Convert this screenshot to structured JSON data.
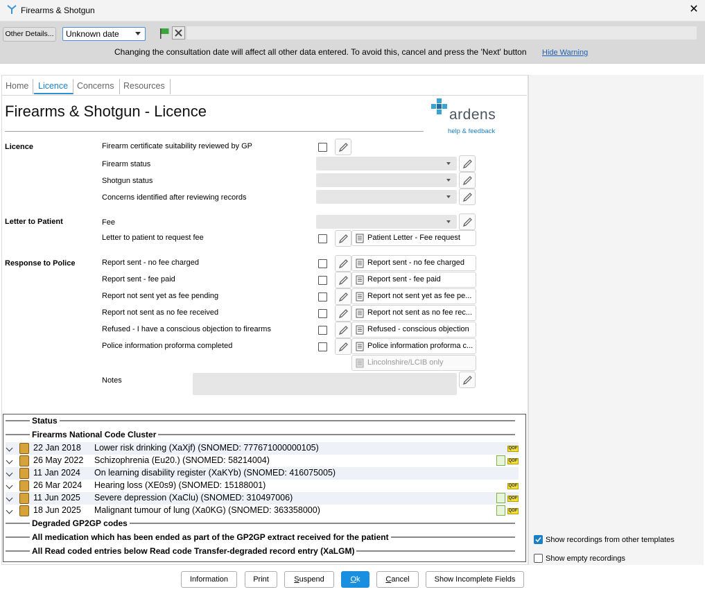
{
  "window": {
    "title": "Firearms & Shotgun",
    "close_glyph": "✕"
  },
  "topbar": {
    "other_details_label": "Other Details...",
    "date_value": "Unknown date",
    "warning_text": "Changing the consultation date will affect all other data entered. To avoid this, cancel and press the 'Next' button",
    "hide_warning_label": "Hide Warning"
  },
  "tabs": [
    {
      "label": "Home"
    },
    {
      "label": "Licence"
    },
    {
      "label": "Concerns"
    },
    {
      "label": "Resources"
    }
  ],
  "page_title": "Firearms & Shotgun - Licence",
  "logo": {
    "word": "ardens",
    "help": "help & feedback"
  },
  "sections": {
    "licence": {
      "heading": "Licence",
      "items": {
        "cert_review": "Firearm certificate suitability reviewed by GP",
        "firearm_status": "Firearm status",
        "shotgun_status": "Shotgun status",
        "concerns": "Concerns identified after reviewing records"
      }
    },
    "letter": {
      "heading": "Letter to Patient",
      "fee": "Fee",
      "letter_request": "Letter to patient to request fee",
      "letter_doc": "Patient Letter - Fee request"
    },
    "police": {
      "heading": "Response to Police",
      "rows": [
        {
          "label": "Report sent - no fee charged",
          "doc": "Report sent - no fee charged"
        },
        {
          "label": "Report sent - fee paid",
          "doc": "Report sent - fee paid"
        },
        {
          "label": "Report not sent yet as fee pending",
          "doc": "Report not sent yet as fee pe..."
        },
        {
          "label": "Report not sent as no fee received",
          "doc": "Report not sent as no fee rec..."
        },
        {
          "label": "Refused - I have a conscious objection to firearms",
          "doc": "Refused - conscious objection"
        },
        {
          "label": "Police information proforma completed",
          "doc": "Police information proforma c..."
        }
      ],
      "extra_doc": "Lincolnshire/LCIB only",
      "notes_label": "Notes"
    }
  },
  "status": {
    "heading": "Status",
    "cluster_heading": "Firearms National Code Cluster",
    "rows": [
      {
        "date": "22 Jan 2018",
        "desc": "Lower risk drinking (XaXjf) (SNOMED: 777671000000105)",
        "doc": false
      },
      {
        "date": "26 May 2022",
        "desc": "Schizophrenia (Eu20.) (SNOMED: 58214004)",
        "doc": true
      },
      {
        "date": "11 Jan 2024",
        "desc": "On learning disability register (XaKYb) (SNOMED: 416075005)",
        "doc": false
      },
      {
        "date": "26 Mar 2024",
        "desc": "Hearing loss (XE0s9) (SNOMED: 15188001)",
        "doc": false
      },
      {
        "date": "11 Jun 2025",
        "desc": "Severe depression (XaClu) (SNOMED: 310497006)",
        "doc": true
      },
      {
        "date": "18 Jun 2025",
        "desc": "Malignant tumour of lung (Xa0KG) (SNOMED: 363358000)",
        "doc": true
      }
    ],
    "qof_label": "QOF",
    "degraded_heading": "Degraded GP2GP codes",
    "medication_heading": "All medication which has been ended as part of the GP2GP extract received for the patient",
    "read_coded_heading": "All Read coded entries below Read code Transfer-degraded record entry (XaLGM)"
  },
  "options": {
    "show_other_templates": {
      "label": "Show recordings from other templates",
      "checked": true
    },
    "show_empty": {
      "label": "Show empty recordings",
      "checked": false
    }
  },
  "buttons": {
    "information": "Information",
    "print": "Print",
    "suspend": "Suspend",
    "ok": "Ok",
    "cancel": "Cancel",
    "show_incomplete": "Show Incomplete Fields"
  },
  "colors": {
    "accent": "#1a7fc4",
    "ok_button": "#1a8fe0",
    "logo_cross": "#3aa3cf"
  }
}
